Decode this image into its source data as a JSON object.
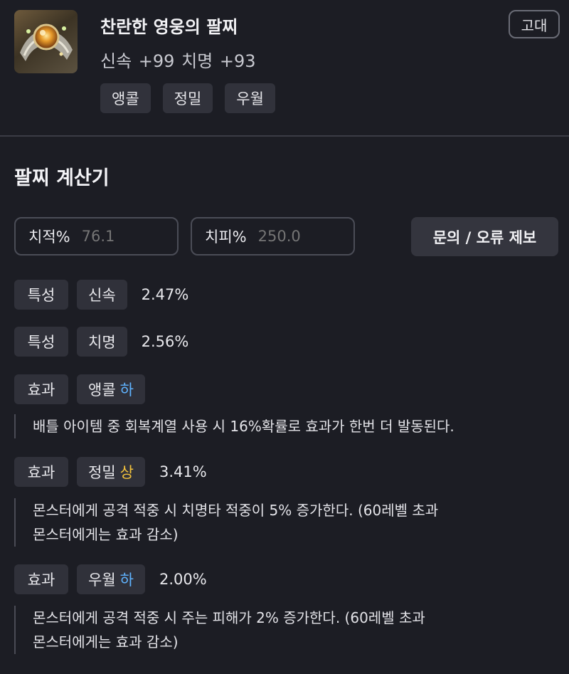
{
  "item": {
    "name": "찬란한 영웅의 팔찌",
    "stats": "신속 +99   치명 +93",
    "grade": "고대",
    "effects": [
      "앵콜",
      "정밀",
      "우월"
    ]
  },
  "calculator": {
    "title": "팔찌 계산기",
    "crit_rate_label": "치적%",
    "crit_rate_value": "76.1",
    "crit_dmg_label": "치피%",
    "crit_dmg_value": "250.0",
    "report_button": "문의 / 오류 제보"
  },
  "traits": [
    {
      "type": "특성",
      "name": "신속",
      "percent": "2.47%"
    },
    {
      "type": "특성",
      "name": "치명",
      "percent": "2.56%"
    }
  ],
  "effects": [
    {
      "type": "효과",
      "name": "앵콜",
      "grade": "하",
      "percent": "",
      "description": [
        "배틀 아이템 중 회복계열 사용 시 16%확률로 효과가 한번 더 발동된다."
      ]
    },
    {
      "type": "효과",
      "name": "정밀",
      "grade": "상",
      "percent": "3.41%",
      "description": [
        "몬스터에게 공격 적중 시 치명타 적중이 5% 증가한다. (60레벨 초과",
        "몬스터에게는 효과 감소)"
      ]
    },
    {
      "type": "효과",
      "name": "우월",
      "grade": "하",
      "percent": "2.00%",
      "description": [
        "몬스터에게 공격 적중 시 주는 피해가 2% 증가한다. (60레벨 초과",
        "몬스터에게는 효과 감소)"
      ]
    }
  ],
  "colors": {
    "background": "#1c1d24",
    "grade_low": "#5fb3ff",
    "grade_high": "#f3c23c"
  },
  "icons": {
    "item_image": "bracelet-icon"
  }
}
